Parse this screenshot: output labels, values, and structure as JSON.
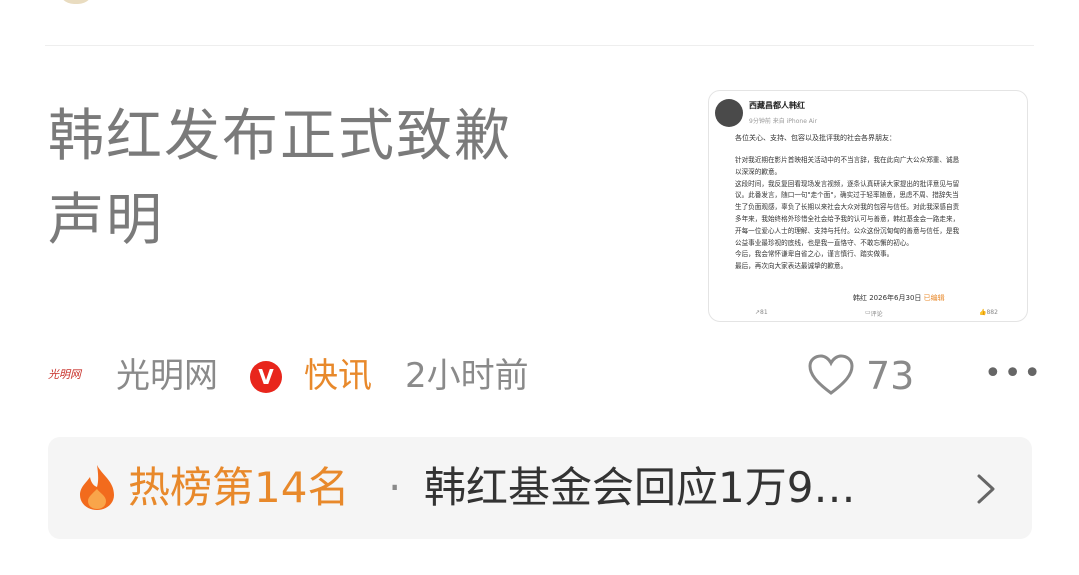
{
  "article": {
    "headline_line1": "韩红发布正式致歉",
    "headline_line2": "声明"
  },
  "thumbnail": {
    "account_name": "西藏昌都人韩红",
    "meta": "9分钟前 来自 iPhone Air",
    "greeting": "各位关心、支持、包容以及批评我的社会各界朋友：",
    "body_lines": [
      "针对我近期在影片首映相关活动中的不当言辞，我在此向广大公众郑重、诚恳",
      "以深深的歉意。",
      "这段时间，我反复回看现场发言视频，逐条认真研读大家提出的批评意见与留",
      "议。此番发言，随口一句\"走个面\"，确实过于轻率随意，思虑不周、措辞失当",
      "生了负面观感，辜负了长期以来社会大众对我的包容与信任。对此我深感自责",
      "多年来，我始终格外珍惜全社会给予我的认可与善意，韩红基金会一路走来，",
      "开每一位爱心人士的理解、支持与托付。公众这份沉甸甸的善意与信任，是我",
      "公益事业最珍视的底线，也是我一直恪守、不敢忘懈的初心。",
      "今后，我会常怀谦卑自省之心，谨言慎行、踏实做事。",
      "最后，再次向大家表达最诚挚的歉意。"
    ],
    "signature": "韩红 2026年6月30日",
    "edited_label": "已编辑",
    "repost_count": "81",
    "comment_label": "评论",
    "like_count": "882"
  },
  "meta": {
    "source_logo_text": "光明网",
    "source_name": "光明网",
    "verified_badge": "V",
    "category": "快讯",
    "time": "2小时前",
    "like_count": "73",
    "more": "•••"
  },
  "hot": {
    "rank_label": "热榜第14名",
    "separator": "·",
    "title": "韩红基金会回应1万9…"
  },
  "colors": {
    "accent_orange": "#e8892b",
    "badge_red": "#e8261c",
    "text_gray": "#8a8a8a",
    "bar_bg": "#f5f5f5"
  },
  "icons": [
    "heart-icon",
    "more-icon",
    "flame-icon",
    "chevron-right-icon",
    "verified-icon"
  ]
}
